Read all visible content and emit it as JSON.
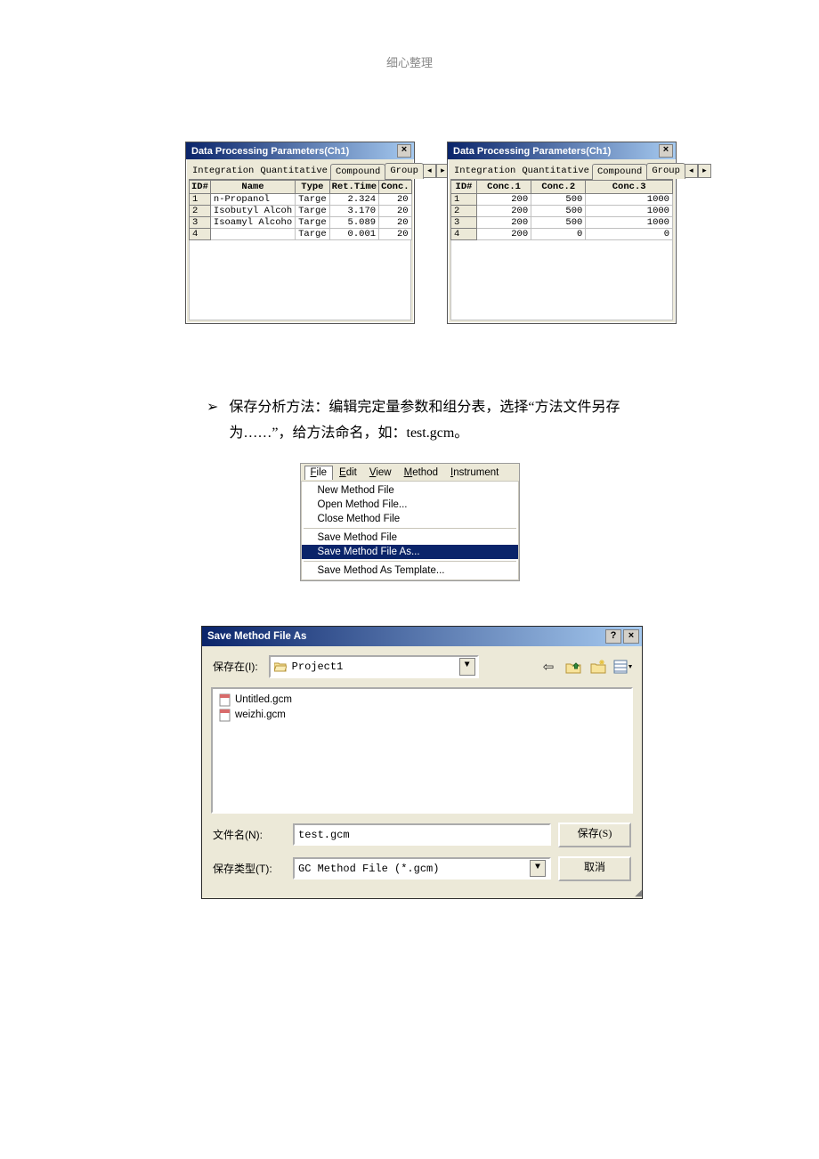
{
  "page_header": "细心整理",
  "dp_left": {
    "title": "Data Processing Parameters(Ch1)",
    "tabs": [
      "Integration",
      "Quantitative",
      "Compound",
      "Group"
    ],
    "cols": [
      "ID#",
      "Name",
      "Type",
      "Ret.Time",
      "Conc."
    ],
    "rows": [
      {
        "id": "1",
        "name": "n-Propanol",
        "type": "Targe",
        "rt": "2.324",
        "conc": "20"
      },
      {
        "id": "2",
        "name": "Isobutyl Alcoh",
        "type": "Targe",
        "rt": "3.170",
        "conc": "20"
      },
      {
        "id": "3",
        "name": "Isoamyl Alcoho",
        "type": "Targe",
        "rt": "5.089",
        "conc": "20"
      },
      {
        "id": "4",
        "name": "",
        "type": "Targe",
        "rt": "0.001",
        "conc": "20"
      }
    ]
  },
  "dp_right": {
    "title": "Data Processing Parameters(Ch1)",
    "tabs": [
      "Integration",
      "Quantitative",
      "Compound",
      "Group"
    ],
    "cols": [
      "ID#",
      "Conc.1",
      "Conc.2",
      "Conc.3"
    ],
    "rows": [
      {
        "id": "1",
        "c1": "200",
        "c2": "500",
        "c3": "1000"
      },
      {
        "id": "2",
        "c1": "200",
        "c2": "500",
        "c3": "1000"
      },
      {
        "id": "3",
        "c1": "200",
        "c2": "500",
        "c3": "1000"
      },
      {
        "id": "4",
        "c1": "200",
        "c2": "0",
        "c3": "0"
      }
    ]
  },
  "paragraph": "保存分析方法：编辑完定量参数和组分表，选择“方法文件另存为……”，给方法命名，如：test.gcm。",
  "bullet": "➢",
  "file_menu": {
    "bar": {
      "file": "File",
      "edit": "Edit",
      "view": "View",
      "method": "Method",
      "instrument": "Instrument"
    },
    "items": {
      "new": "New Method File",
      "open": "Open Method File...",
      "close": "Close Method File",
      "save": "Save Method File",
      "saveas": "Save Method File As...",
      "tmpl": "Save Method As Template..."
    }
  },
  "save_dialog": {
    "title": "Save Method File As",
    "save_in_label": "保存在(I):",
    "save_in_value": "Project1",
    "files": [
      "Untitled.gcm",
      "weizhi.gcm"
    ],
    "filename_label": "文件名(N):",
    "filename_value": "test.gcm",
    "filetype_label": "保存类型(T):",
    "filetype_value": "GC Method File (*.gcm)",
    "save_btn": "保存(S)",
    "cancel_btn": "取消"
  }
}
